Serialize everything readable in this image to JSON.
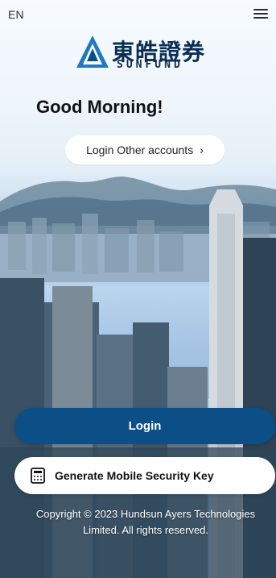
{
  "header": {
    "language": "EN",
    "menu_icon": "hamburger-menu-icon"
  },
  "brand": {
    "name_cn": "東皓證券",
    "name_en": "SUNFUND",
    "logo_icon": "sunfund-logo-icon"
  },
  "greeting": "Good Morning!",
  "actions": {
    "login_other_accounts": "Login Other accounts",
    "login_other_accounts_icon": "chevron-right-icon",
    "login": "Login",
    "generate_key": "Generate Mobile Security Key",
    "generate_key_icon": "calculator-icon"
  },
  "footer": {
    "copyright": "Copyright © 2023 Hundsun Ayers Technologies Limited. All rights reserved."
  },
  "colors": {
    "primary": "#0b4f86",
    "brand_text": "#0b2e55"
  }
}
